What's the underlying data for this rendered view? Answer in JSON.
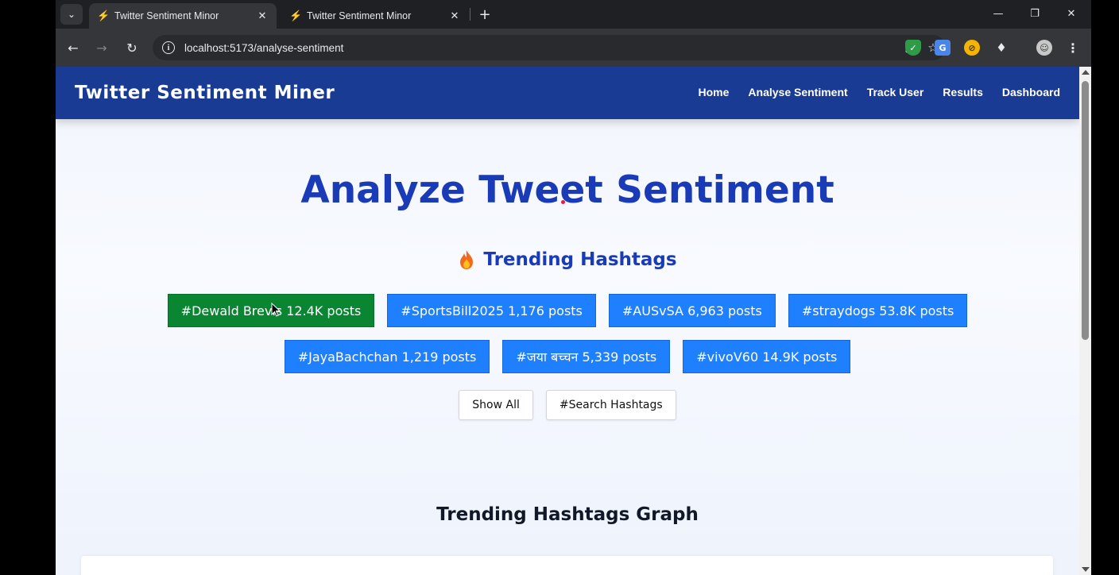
{
  "browser": {
    "tabs": [
      {
        "title": "Twitter Sentiment Minor",
        "active": true,
        "favicon": "bolt-icon"
      },
      {
        "title": "Twitter Sentiment Minor",
        "active": false,
        "favicon": "bolt-icon"
      }
    ],
    "url": "localhost:5173/analyse-sentiment"
  },
  "app": {
    "brand": "Twitter Sentiment Miner",
    "nav": [
      "Home",
      "Analyse Sentiment",
      "Track User",
      "Results",
      "Dashboard"
    ],
    "heading": "Analyze Tweet Sentiment",
    "trending_title": "Trending Hashtags",
    "hashtags_row1": [
      {
        "label": "#Dewald Brevis 12.4K posts",
        "selected": true
      },
      {
        "label": "#SportsBill2025 1,176 posts",
        "selected": false
      },
      {
        "label": "#AUSvSA 6,963 posts",
        "selected": false
      },
      {
        "label": "#straydogs 53.8K posts",
        "selected": false
      }
    ],
    "hashtags_row2": [
      {
        "label": "#JayaBachchan 1,219 posts",
        "selected": false
      },
      {
        "label": "#जया बच्चन 5,339 posts",
        "selected": false
      },
      {
        "label": "#vivoV60 14.9K posts",
        "selected": false
      }
    ],
    "show_all": "Show All",
    "search_hashtags": "#Search Hashtags",
    "graph_title": "Trending Hashtags Graph"
  },
  "colors": {
    "navbar": "#1a3b94",
    "heading": "#1a3bb8",
    "tag": "#1f80ff",
    "tag_selected": "#0a8531"
  }
}
